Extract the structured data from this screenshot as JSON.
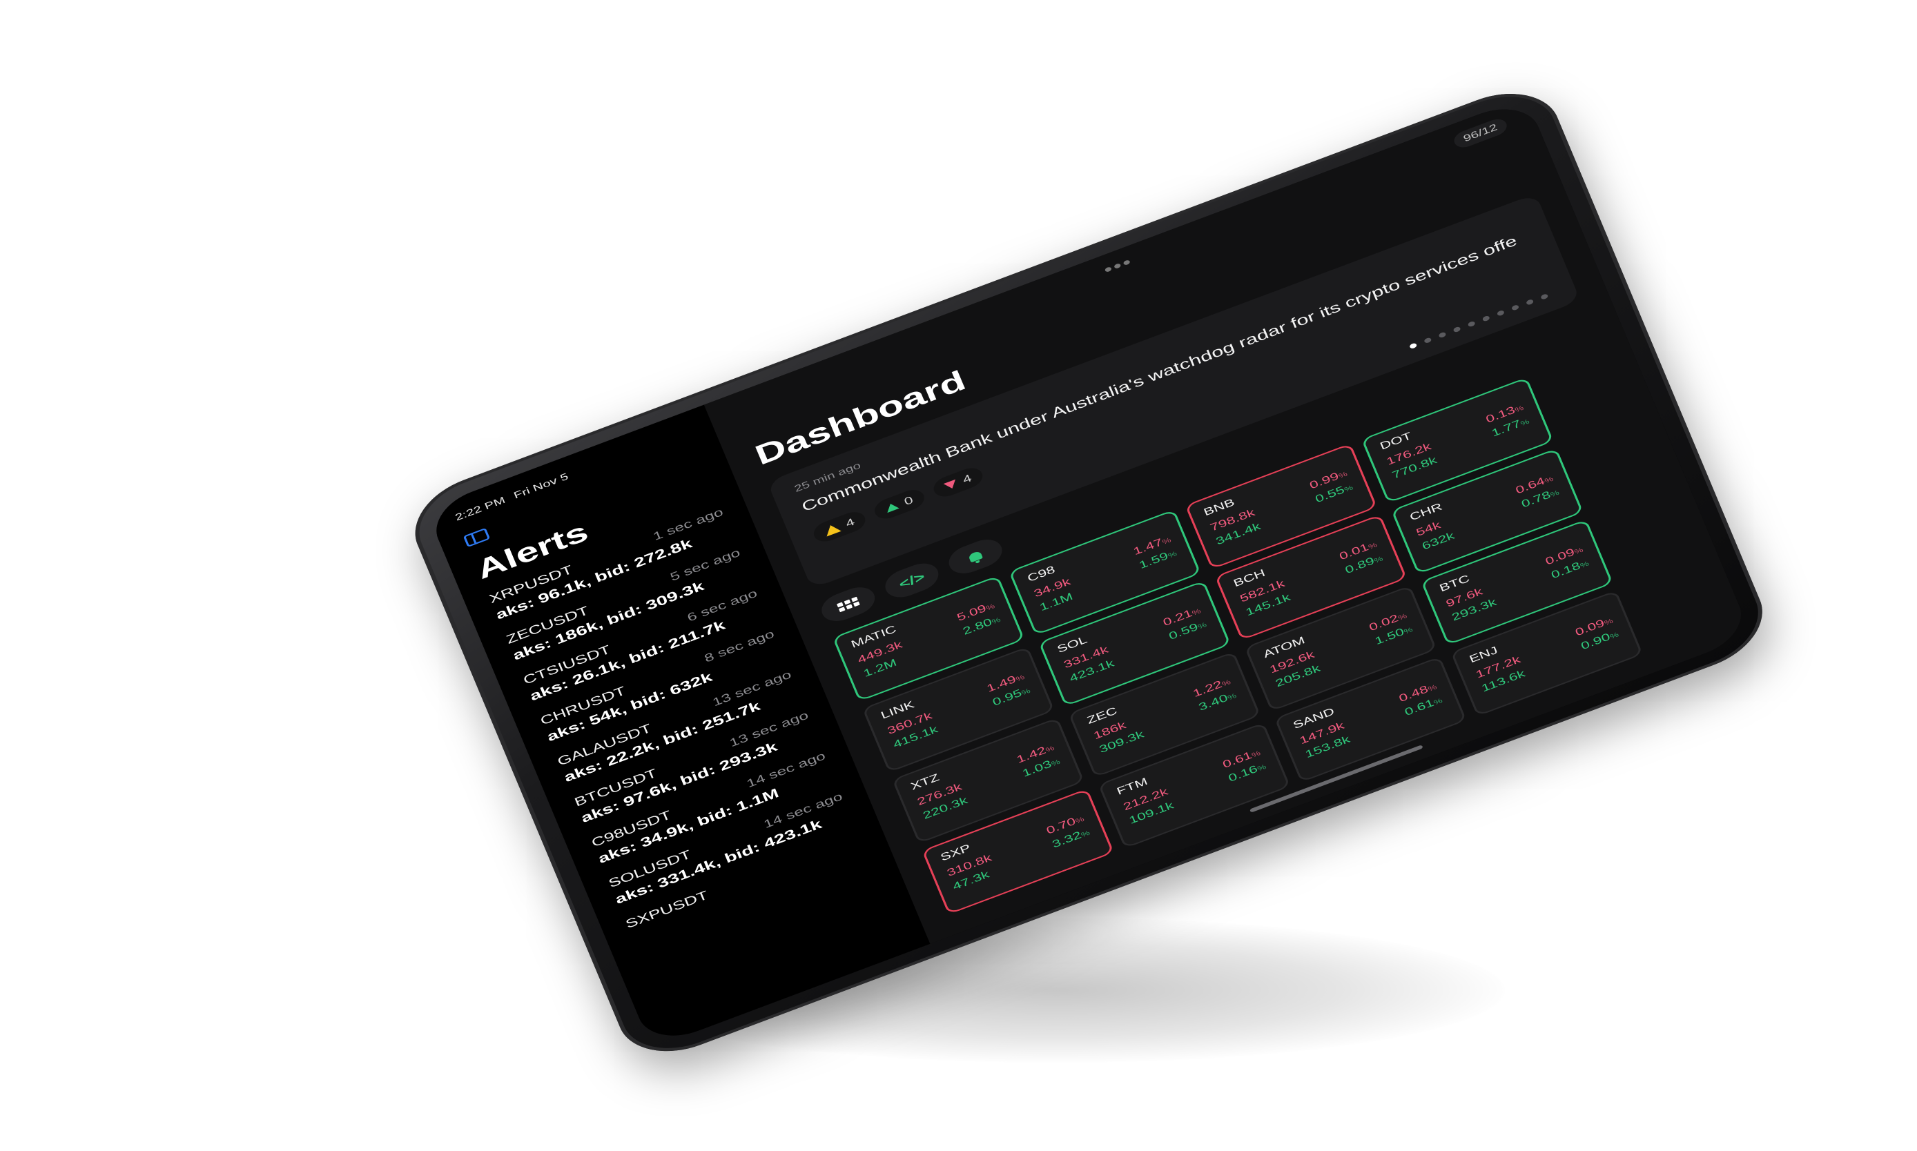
{
  "status": {
    "time": "2:22 PM",
    "date": "Fri Nov 5"
  },
  "sidebar": {
    "title": "Alerts",
    "alerts": [
      {
        "symbol": "XRPUSDT",
        "detail": "aks: 96.1k, bid: 272.8k",
        "time": "1 sec ago"
      },
      {
        "symbol": "ZECUSDT",
        "detail": "aks: 186k, bid: 309.3k",
        "time": "5 sec ago"
      },
      {
        "symbol": "CTSIUSDT",
        "detail": "aks: 26.1k, bid: 211.7k",
        "time": "6 sec ago"
      },
      {
        "symbol": "CHRUSDT",
        "detail": "aks: 54k, bid: 632k",
        "time": "8 sec ago"
      },
      {
        "symbol": "GALAUSDT",
        "detail": "aks: 22.2k, bid: 251.7k",
        "time": "13 sec ago"
      },
      {
        "symbol": "BTCUSDT",
        "detail": "aks: 97.6k, bid: 293.3k",
        "time": "13 sec ago"
      },
      {
        "symbol": "C98USDT",
        "detail": "aks: 34.9k, bid: 1.1M",
        "time": "14 sec ago"
      },
      {
        "symbol": "SOLUSDT",
        "detail": "aks: 331.4k, bid: 423.1k",
        "time": "14 sec ago"
      },
      {
        "symbol": "SXPUSDT",
        "detail": "",
        "time": ""
      }
    ]
  },
  "main": {
    "title": "Dashboard",
    "page_counter": "96/12",
    "news": {
      "time": "25 min ago",
      "headline": "Commonwealth Bank under Australia's watchdog radar for its crypto services offe",
      "counters": {
        "warning": "4",
        "up": "0",
        "down": "4"
      },
      "pager_total": 10,
      "pager_active": 0
    },
    "tiles": [
      {
        "symbol": "MATIC",
        "ask": "449.3k",
        "bid": "1.2M",
        "pct_red": "5.09",
        "pct_green": "2.80",
        "state": "up"
      },
      {
        "symbol": "C98",
        "ask": "34.9k",
        "bid": "1.1M",
        "pct_red": "1.47",
        "pct_green": "1.59",
        "state": "up"
      },
      {
        "symbol": "BNB",
        "ask": "798.8k",
        "bid": "341.4k",
        "pct_red": "0.99",
        "pct_green": "0.55",
        "state": "down"
      },
      {
        "symbol": "DOT",
        "ask": "176.2k",
        "bid": "770.8k",
        "pct_red": "0.13",
        "pct_green": "1.77",
        "state": "up"
      },
      {
        "symbol": "LINK",
        "ask": "360.7k",
        "bid": "415.1k",
        "pct_red": "1.49",
        "pct_green": "0.95",
        "state": "none"
      },
      {
        "symbol": "SOL",
        "ask": "331.4k",
        "bid": "423.1k",
        "pct_red": "0.21",
        "pct_green": "0.59",
        "state": "up"
      },
      {
        "symbol": "BCH",
        "ask": "582.1k",
        "bid": "145.1k",
        "pct_red": "0.01",
        "pct_green": "0.89",
        "state": "down"
      },
      {
        "symbol": "CHR",
        "ask": "54k",
        "bid": "632k",
        "pct_red": "0.64",
        "pct_green": "0.78",
        "state": "up"
      },
      {
        "symbol": "XTZ",
        "ask": "276.3k",
        "bid": "220.3k",
        "pct_red": "1.42",
        "pct_green": "1.03",
        "state": "none"
      },
      {
        "symbol": "ZEC",
        "ask": "186k",
        "bid": "309.3k",
        "pct_red": "1.22",
        "pct_green": "3.40",
        "state": "none"
      },
      {
        "symbol": "ATOM",
        "ask": "192.6k",
        "bid": "205.8k",
        "pct_red": "0.02",
        "pct_green": "1.50",
        "state": "none"
      },
      {
        "symbol": "BTC",
        "ask": "97.6k",
        "bid": "293.3k",
        "pct_red": "0.09",
        "pct_green": "0.18",
        "state": "up"
      },
      {
        "symbol": "SXP",
        "ask": "310.8k",
        "bid": "47.3k",
        "pct_red": "0.70",
        "pct_green": "3.32",
        "state": "down"
      },
      {
        "symbol": "FTM",
        "ask": "212.2k",
        "bid": "109.1k",
        "pct_red": "0.61",
        "pct_green": "0.16",
        "state": "none"
      },
      {
        "symbol": "SAND",
        "ask": "147.9k",
        "bid": "153.8k",
        "pct_red": "0.48",
        "pct_green": "0.61",
        "state": "none"
      },
      {
        "symbol": "ENJ",
        "ask": "177.2k",
        "bid": "113.6k",
        "pct_red": "0.09",
        "pct_green": "0.90",
        "state": "none"
      }
    ],
    "pct_unit": "%"
  },
  "colors": {
    "accent": "#2f7cf6",
    "positive": "#2fc77b",
    "negative": "#f05a7e",
    "warning": "#f5c21b"
  },
  "icons": {
    "sidebar_toggle": "sidebar-toggle-icon",
    "grid": "grid-icon",
    "code": "code-icon",
    "bell": "bell-icon"
  }
}
